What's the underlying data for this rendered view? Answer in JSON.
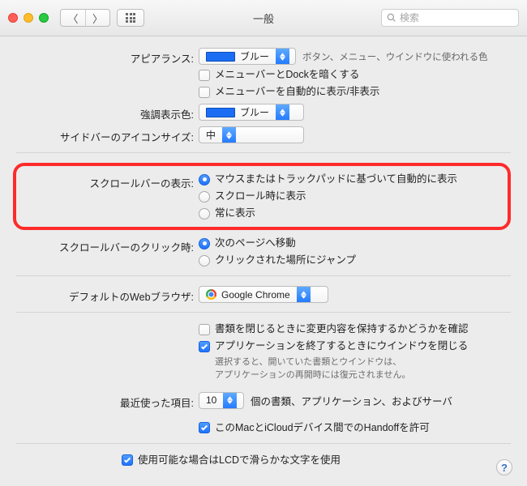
{
  "window": {
    "title": "一般"
  },
  "search": {
    "placeholder": "検索"
  },
  "appearance": {
    "label": "アピアランス:",
    "value": "ブルー",
    "hint": "ボタン、メニュー、ウインドウに使われる色",
    "menubar_dark": "メニューバーとDockを暗くする",
    "menubar_dark_checked": false,
    "menubar_autohide": "メニューバーを自動的に表示/非表示",
    "menubar_autohide_checked": false
  },
  "highlight": {
    "label": "強調表示色:",
    "value": "ブルー"
  },
  "sidebar_icon": {
    "label": "サイドバーのアイコンサイズ:",
    "value": "中"
  },
  "scrollbar_show": {
    "label": "スクロールバーの表示:",
    "options": [
      "マウスまたはトラックパッドに基づいて自動的に表示",
      "スクロール時に表示",
      "常に表示"
    ],
    "selected": 0
  },
  "scrollbar_click": {
    "label": "スクロールバーのクリック時:",
    "options": [
      "次のページへ移動",
      "クリックされた場所にジャンプ"
    ],
    "selected": 0
  },
  "default_browser": {
    "label": "デフォルトのWebブラウザ:",
    "value": "Google Chrome"
  },
  "documents": {
    "ask_save": "書類を閉じるときに変更内容を保持するかどうかを確認",
    "ask_save_checked": false,
    "close_windows": "アプリケーションを終了するときにウインドウを閉じる",
    "close_windows_checked": true,
    "note1": "選択すると、開いていた書類とウインドウは、",
    "note2": "アプリケーションの再開時には復元されません。"
  },
  "recent": {
    "label": "最近使った項目:",
    "value": "10",
    "suffix": "個の書類、アプリケーション、およびサーバ"
  },
  "handoff": {
    "text": "このMacとiCloudデバイス間でのHandoffを許可",
    "checked": true
  },
  "lcd": {
    "text": "使用可能な場合はLCDで滑らかな文字を使用",
    "checked": true
  },
  "help": "?"
}
